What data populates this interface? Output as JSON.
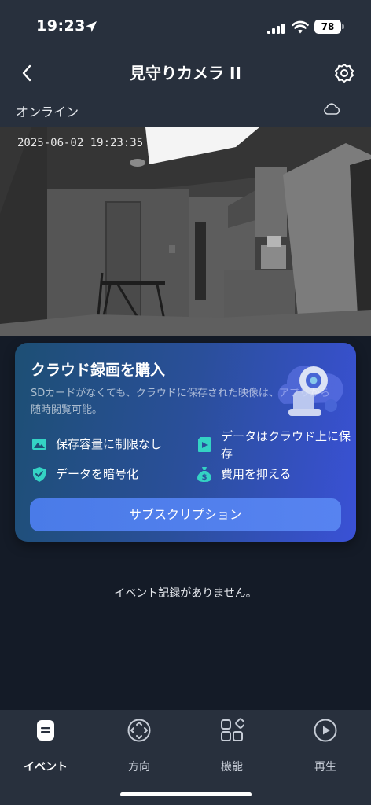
{
  "status_bar": {
    "time": "19:23",
    "battery": "78"
  },
  "header": {
    "title": "見守りカメラ II"
  },
  "connection": {
    "status": "オンライン"
  },
  "camera": {
    "timestamp": "2025-06-02 19:23:35"
  },
  "promo": {
    "title": "クラウド録画を購入",
    "description": "SDカードがなくても、クラウドに保存された映像は、アプリから随時閲覧可能。",
    "features": [
      {
        "label": "保存容量に制限なし",
        "icon": "image-icon"
      },
      {
        "label": "データはクラウド上に保存",
        "icon": "sd-card-icon"
      },
      {
        "label": "データを暗号化",
        "icon": "shield-check-icon"
      },
      {
        "label": "費用を抑える",
        "icon": "money-bag-icon"
      }
    ],
    "button_label": "サブスクリプション"
  },
  "events": {
    "empty_message": "イベント記録がありません。"
  },
  "tabs": [
    {
      "label": "イベント",
      "icon": "event-icon",
      "active": true
    },
    {
      "label": "方向",
      "icon": "direction-icon",
      "active": false
    },
    {
      "label": "機能",
      "icon": "features-grid-icon",
      "active": false
    },
    {
      "label": "再生",
      "icon": "play-icon",
      "active": false
    }
  ],
  "colors": {
    "background": "#141b27",
    "header": "#28303d",
    "accent_button": "#5783f0",
    "feature_icon": "#34d3c4"
  }
}
